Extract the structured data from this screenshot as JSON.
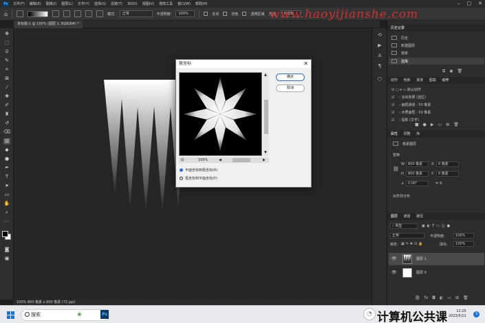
{
  "app": {
    "logo": "Ps"
  },
  "menubar": {
    "items": [
      "文件(F)",
      "编辑(E)",
      "图像(I)",
      "图层(L)",
      "文字(Y)",
      "选择(S)",
      "滤镜(T)",
      "3D(D)",
      "视图(V)",
      "增效工具",
      "窗口(W)",
      "帮助(H)"
    ]
  },
  "watermark": "www.haoyijianshe.com",
  "optionsbar": {
    "mode_label": "模式:",
    "mode_value": "正常",
    "opacity_label": "不透明度:",
    "opacity_value": "100%",
    "reverse_label": "反向",
    "dither_label": "仿色",
    "transparency_label": "透明区域",
    "method_label": "方法:",
    "method_value": "可感知"
  },
  "document": {
    "tab_title": "未标题-1 @ 100% (图层 1, RGB/8#) *",
    "status_text": "100%    800 像素 x 800 像素 (72 ppi)"
  },
  "dialog": {
    "title": "极坐标",
    "ok_label": "确定",
    "cancel_label": "取消",
    "zoom_value": "100%",
    "option_1": "平面坐标到极坐标(R)",
    "option_2": "极坐标到平面坐标(P)",
    "selected_option": 1
  },
  "panels": {
    "history_header": [
      "历史记录"
    ],
    "history_items": [
      "历史",
      "新建图层",
      "渐变",
      "选择"
    ],
    "actions_tabs": [
      "动作",
      "色板",
      "渐变",
      "图案",
      "动作"
    ],
    "actions_items": [
      "默认动作",
      "淡出效果 (选区)",
      "画框通道 - 50 像素",
      "木质画框 - 50 像素",
      "投影 (文字)"
    ],
    "properties_tabs": [
      "属性",
      "调整",
      "库"
    ],
    "properties_title": "像素图层",
    "transform_label": "变换",
    "w_label": "W",
    "w_value": "800 像素",
    "h_label": "H",
    "h_value": "800 像素",
    "x_label": "X",
    "x_value": "0 像素",
    "y_label": "Y",
    "y_value": "0 像素",
    "angle_value": "0.00°",
    "align_label": "对齐并分布",
    "layers_tabs": [
      "图层",
      "通道",
      "路径"
    ],
    "layers_kind": "类型",
    "blend_mode": "正常",
    "opacity_label": "不透明度:",
    "opacity_value": "100%",
    "lock_label": "锁定:",
    "fill_label": "填充:",
    "fill_value": "100%",
    "layers": [
      {
        "name": "图层 1",
        "selected": true
      },
      {
        "name": "图层 0",
        "selected": false
      }
    ]
  },
  "taskbar": {
    "search_placeholder": "搜索",
    "brand_text": "计算机公共课",
    "time": "12:25",
    "date": "2023/5/21",
    "notification_count": "3"
  },
  "colors": {
    "accent": "#2a6fd0",
    "watermark": "#d23030",
    "ps_blue": "#47b4ff"
  }
}
